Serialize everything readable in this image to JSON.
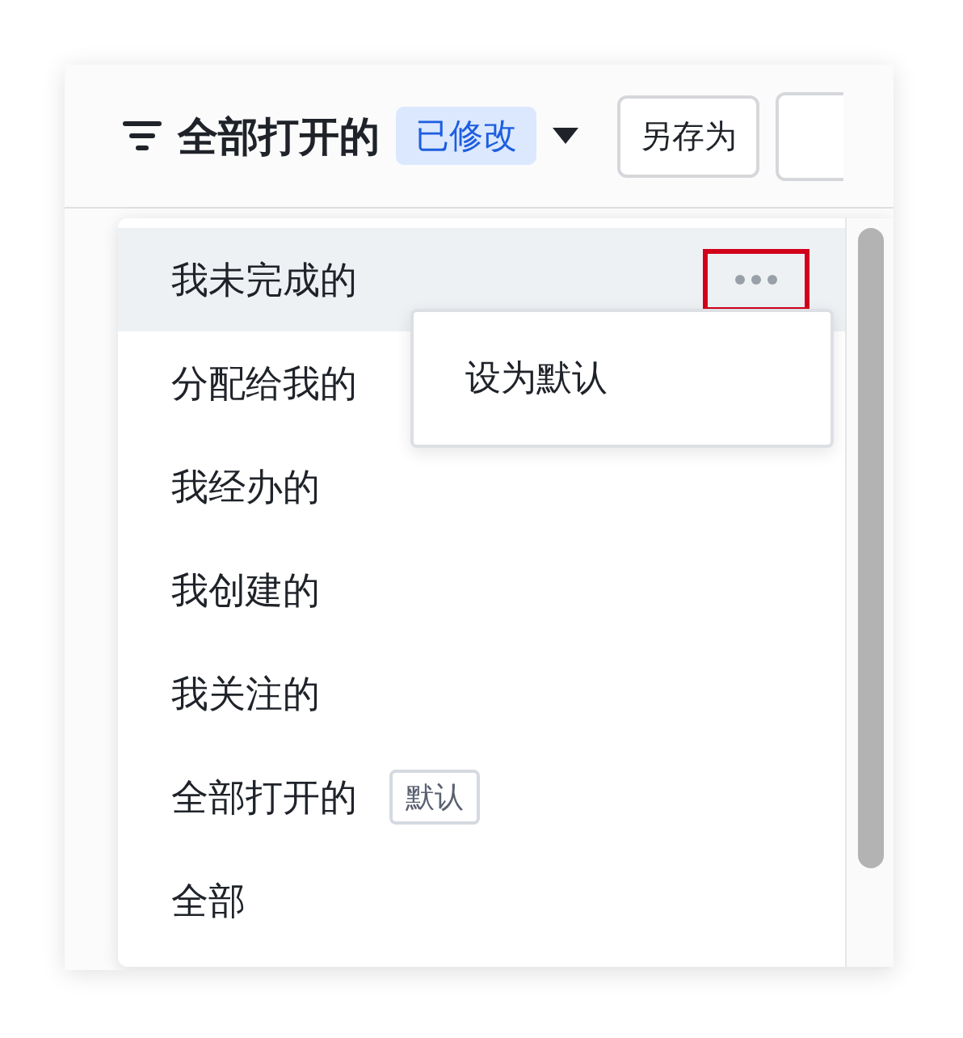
{
  "header": {
    "title": "全部打开的",
    "badge": "已修改",
    "save_as_button": "另存为"
  },
  "view_menu": {
    "items": [
      {
        "label": "我未完成的",
        "hovered": true,
        "more_highlighted": true
      },
      {
        "label": "分配给我的",
        "hovered": false
      },
      {
        "label": "我经办的",
        "hovered": false
      },
      {
        "label": "我创建的",
        "hovered": false
      },
      {
        "label": "我关注的",
        "hovered": false
      },
      {
        "label": "全部打开的",
        "hovered": false,
        "tag": "默认"
      },
      {
        "label": "全部",
        "hovered": false
      }
    ]
  },
  "context_menu": {
    "items": [
      "设为默认"
    ]
  }
}
